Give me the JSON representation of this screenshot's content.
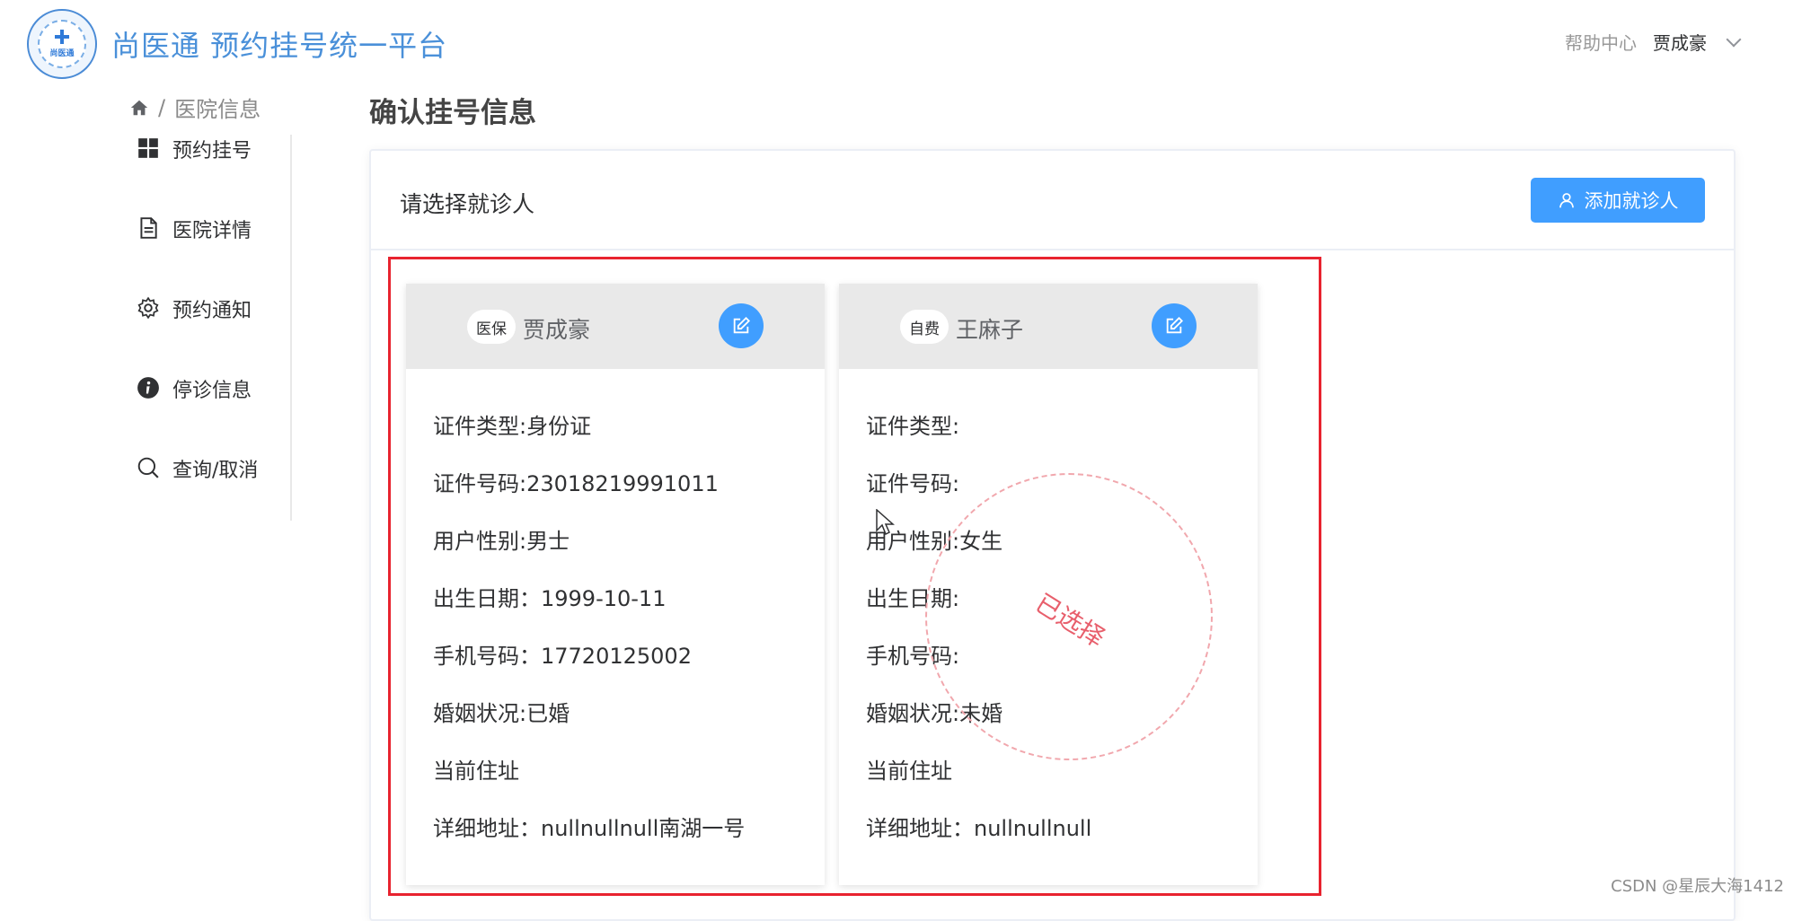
{
  "header": {
    "logo_text": "尚医通",
    "brand": "尚医通 预约挂号统一平台",
    "help": "帮助中心",
    "user": "贾成豪"
  },
  "breadcrumb": {
    "current": "医院信息"
  },
  "sidebar": {
    "items": [
      {
        "label": "预约挂号",
        "icon": "grid-icon"
      },
      {
        "label": "医院详情",
        "icon": "document-icon"
      },
      {
        "label": "预约通知",
        "icon": "gear-icon"
      },
      {
        "label": "停诊信息",
        "icon": "info-icon"
      },
      {
        "label": "查询/取消",
        "icon": "search-icon"
      }
    ]
  },
  "main": {
    "title": "确认挂号信息",
    "panel_title": "请选择就诊人",
    "add_button": "添加就诊人"
  },
  "patients": [
    {
      "tag": "医保",
      "name": "贾成豪",
      "rows": [
        "证件类型:身份证",
        "证件号码:23018219991011",
        "用户性别:男士",
        "出生日期：1999-10-11",
        "手机号码：17720125002",
        "婚姻状况:已婚",
        "当前住址",
        "详细地址：nullnullnull南湖一号"
      ]
    },
    {
      "tag": "自费",
      "name": "王麻子",
      "rows": [
        "证件类型:",
        "证件号码:",
        "用户性别:女生",
        "出生日期:",
        "手机号码:",
        "婚姻状况:未婚",
        "当前住址",
        "详细地址：nullnullnull"
      ]
    }
  ],
  "selected_stamp": "已选择",
  "watermark": "CSDN @星辰大海1412",
  "colors": {
    "brand": "#4a90d9",
    "primary": "#409eff",
    "highlight_border": "#e8232f",
    "stamp": "#e85f6c"
  }
}
